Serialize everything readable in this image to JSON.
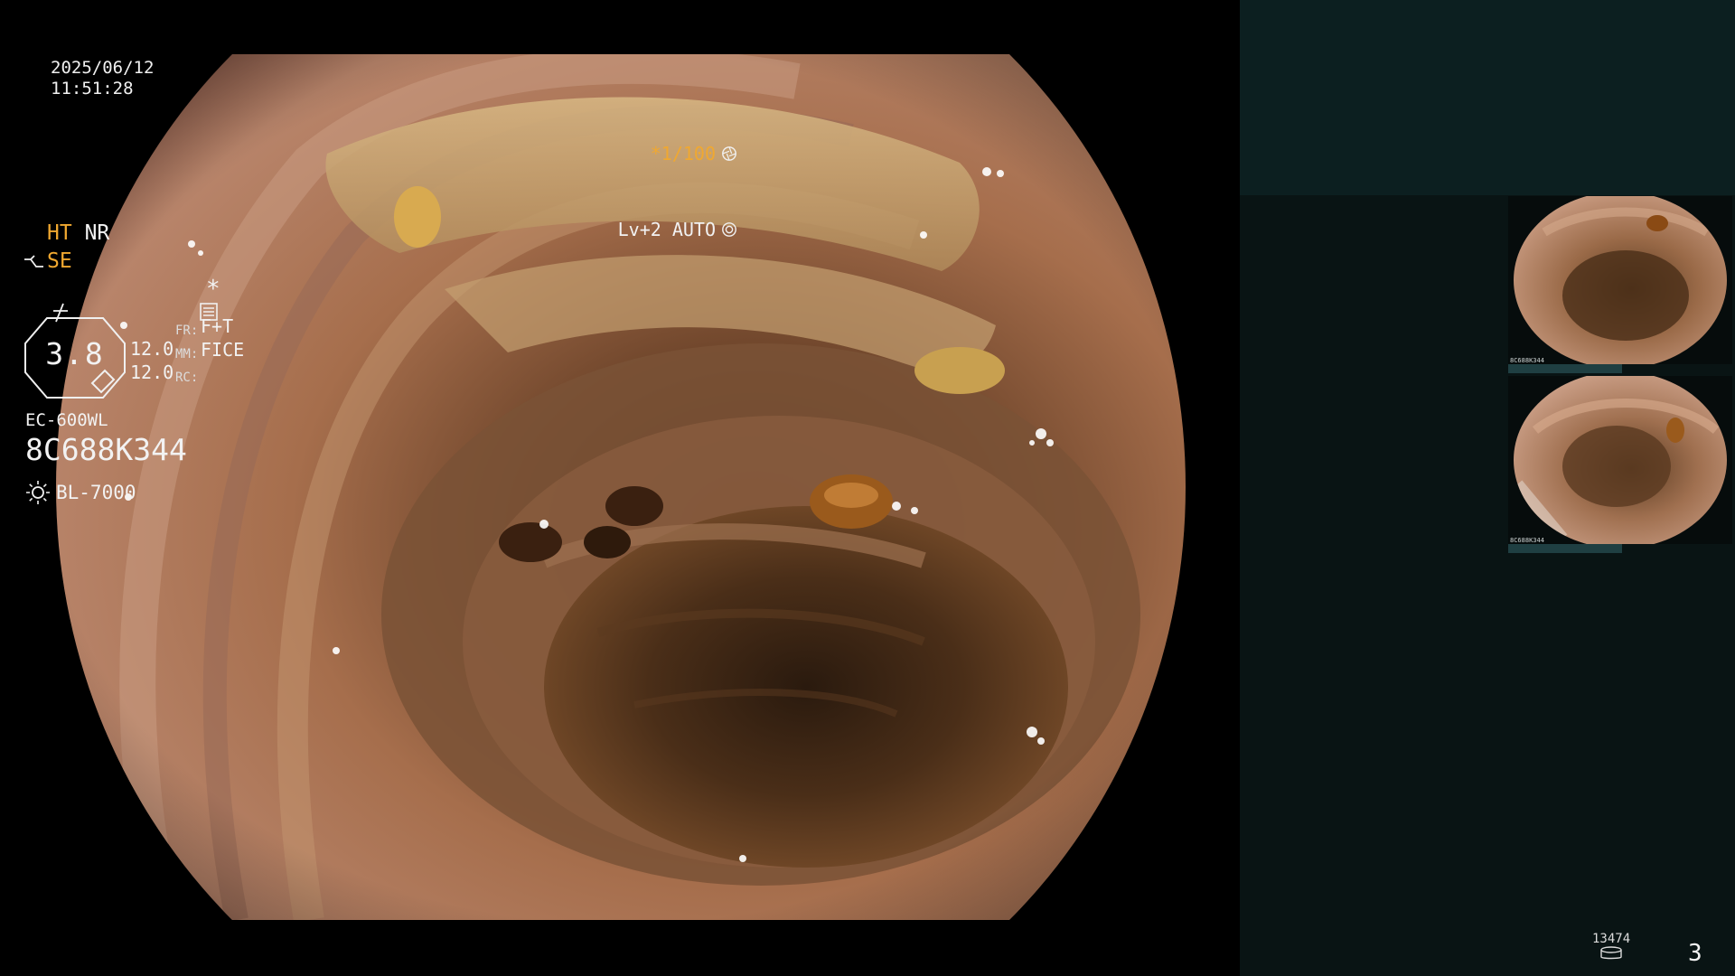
{
  "overlay": {
    "date": "2025/06/12",
    "time": "11:51:28",
    "shutter_speed": "*1/100",
    "level_mode": "Lv+2 AUTO"
  },
  "panel": {
    "ht": "HT",
    "nr": "NR",
    "se": "SE",
    "gauge_value": "3.8",
    "value_1": "12.0",
    "value_2": "12.0",
    "fr_label": "FR:",
    "fr_value": "F+T",
    "mm_label": "MM:",
    "mm_value": "FICE",
    "rc_label": "RC:",
    "scope_model": "EC-600WL",
    "scope_serial": "8C688K344",
    "light_source": "BL-7000",
    "image_count": "13474",
    "page_number": "3"
  },
  "thumbnails": [
    {
      "caption": "8C688K344"
    },
    {
      "caption": "8C688K344"
    }
  ],
  "colors": {
    "highlight_amber": "#f0a830",
    "panel_bg": "#091414",
    "panel_top_bg": "#0c1f20"
  }
}
